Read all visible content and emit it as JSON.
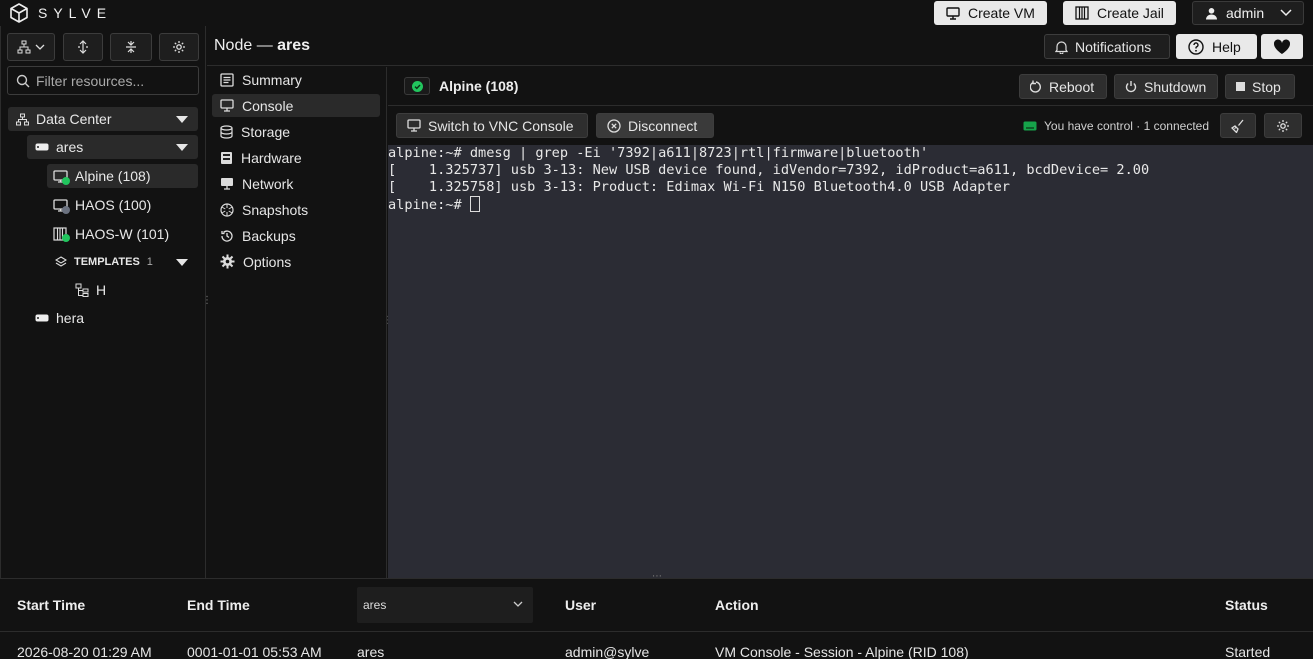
{
  "app": {
    "brand": "SYLVE",
    "create_vm": "Create VM",
    "create_jail": "Create Jail",
    "user": "admin"
  },
  "sidebar": {
    "filter_placeholder": "Filter resources...",
    "tree": {
      "datacenter": "Data Center",
      "node1": "ares",
      "vms": [
        {
          "label": "Alpine (108)",
          "status": "running"
        },
        {
          "label": "HAOS (100)",
          "status": "stopped"
        },
        {
          "label": "HAOS-W (101)",
          "status": "running"
        }
      ],
      "templates_label": "TEMPLATES",
      "templates_count": "1",
      "template_item": "H",
      "node2": "hera"
    }
  },
  "header": {
    "node_prefix": "Node —",
    "node_name": "ares",
    "notifications": "Notifications",
    "help": "Help"
  },
  "nav": {
    "items": [
      "Summary",
      "Console",
      "Storage",
      "Hardware",
      "Network",
      "Snapshots",
      "Backups",
      "Options"
    ],
    "active": "Console"
  },
  "vm": {
    "title": "Alpine (108)",
    "reboot": "Reboot",
    "shutdown": "Shutdown",
    "stop": "Stop"
  },
  "console": {
    "switch": "Switch to VNC Console",
    "disconnect": "Disconnect",
    "control_status": "You have control · 1 connected",
    "lines": [
      "alpine:~# dmesg | grep -Ei '7392|a611|8723|rtl|firmware|bluetooth'",
      "[    1.325737] usb 3-13: New USB device found, idVendor=7392, idProduct=a611, bcdDevice= 2.00",
      "[    1.325758] usb 3-13: Product: Edimax Wi-Fi N150 Bluetooth4.0 USB Adapter",
      "alpine:~# "
    ]
  },
  "table": {
    "headers": {
      "start": "Start Time",
      "end": "End Time",
      "user": "User",
      "action": "Action",
      "status": "Status"
    },
    "node_filter": "ares",
    "row": {
      "start": "2026-08-20 01:29 AM",
      "end": "0001-01-01 05:53 AM",
      "node": "ares",
      "user": "admin@sylve",
      "action": "VM Console - Session - Alpine (RID 108)",
      "status": "Started"
    }
  },
  "colors": {
    "running": "#22c55e",
    "stopped": "#6b7280",
    "terminal_bg": "#2b2c34"
  }
}
